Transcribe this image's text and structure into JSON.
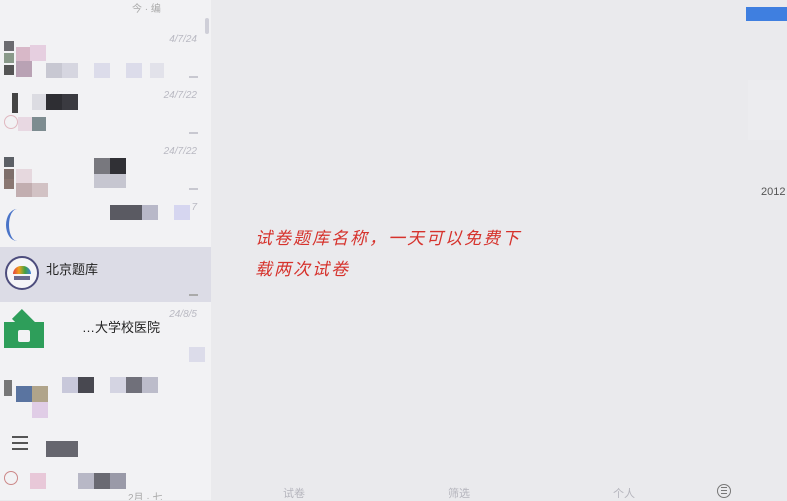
{
  "sidebar": {
    "header_fragment": "今 · 编",
    "chats": [
      {
        "name": "",
        "time": "4/7/24"
      },
      {
        "name": "",
        "time": "24/7/22"
      },
      {
        "name": "",
        "time": "24/7/22"
      },
      {
        "name": "",
        "time": "7"
      },
      {
        "name": "北京题库",
        "time": ""
      },
      {
        "name": "…大学校医院",
        "time": "24/8/5"
      },
      {
        "name": "",
        "time": ""
      },
      {
        "name": "",
        "time": ""
      },
      {
        "name": "",
        "time": ""
      }
    ],
    "footer_fragment": "2月 · 七"
  },
  "main": {
    "annotation_line1": "试卷题库名称，一天可以免费下",
    "annotation_line2": "载两次试卷",
    "year_label": "2012"
  },
  "tabs": [
    "试卷",
    "筛选",
    "个人"
  ],
  "icons": {
    "menu": "menu-icon",
    "settings": "settings-icon"
  },
  "colors": {
    "annotation": "#d6322c",
    "accent": "#3f7fe0"
  }
}
